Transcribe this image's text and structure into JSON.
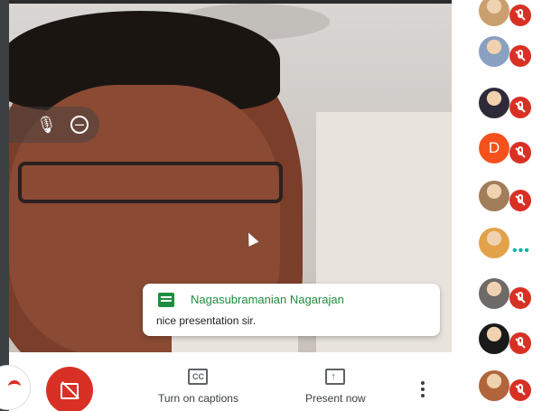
{
  "chat": {
    "sender": "Nagasubramanian Nagarajan",
    "message": "nice presentation sir."
  },
  "toolbar": {
    "captions_label": "Turn on captions",
    "present_label": "Present now",
    "captions_icon_text": "CC"
  },
  "participants": [
    {
      "type": "photo",
      "color": "#c9a06d",
      "muted": true
    },
    {
      "type": "photo",
      "color": "#8aa0c0",
      "muted": true
    },
    {
      "type": "photo",
      "color": "#2f2a3a",
      "muted": true
    },
    {
      "type": "initial",
      "initial": "D",
      "color": "#f4511e",
      "muted": true
    },
    {
      "type": "photo",
      "color": "#a27d5a",
      "muted": true
    },
    {
      "type": "photo",
      "color": "#e2a24a",
      "muted": false,
      "speaking": true
    },
    {
      "type": "photo",
      "color": "#6e6a68",
      "muted": true
    },
    {
      "type": "photo",
      "color": "#1a1a1a",
      "muted": true
    },
    {
      "type": "photo",
      "color": "#b2653a",
      "muted": true
    }
  ],
  "colors": {
    "accent_green": "#1e8e3e",
    "danger_red": "#d93025",
    "speaking_teal": "#00b3a6"
  }
}
